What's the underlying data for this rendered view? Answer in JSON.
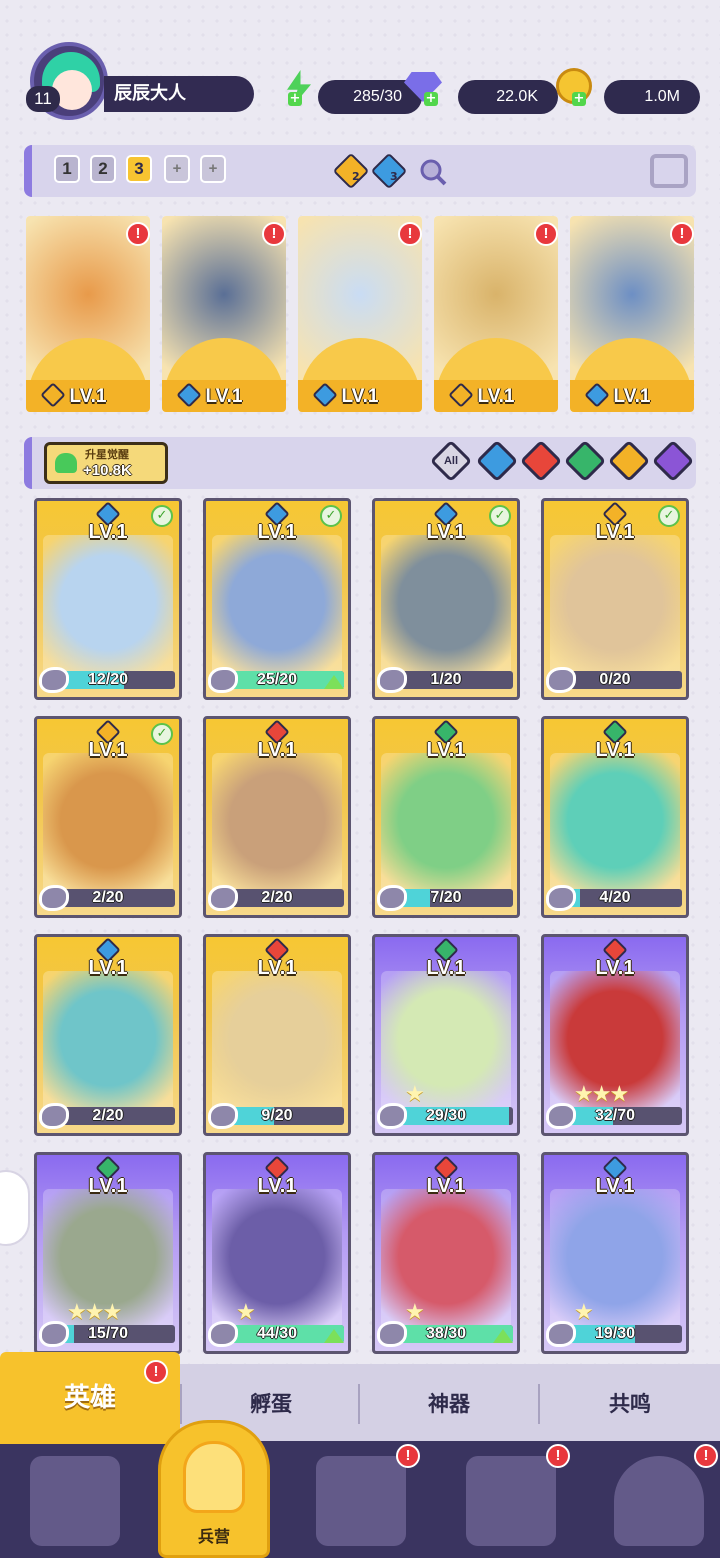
{
  "player": {
    "level": "11",
    "name": "辰辰大人"
  },
  "resources": [
    {
      "name": "energy",
      "icon": "lightning-icon",
      "value": "285/30",
      "color": "#4ed15a"
    },
    {
      "name": "gems",
      "icon": "gem-icon",
      "value": "22.0K",
      "color": "#7a6ee8"
    },
    {
      "name": "coins",
      "icon": "coin-icon",
      "value": "1.0M",
      "color": "#f5c531"
    }
  ],
  "team": {
    "slots": [
      "1",
      "2",
      "3",
      "+",
      "+"
    ],
    "active_slot": "3",
    "element_counts": [
      {
        "icon": "light-element-icon",
        "count": "2",
        "color": "#f3b227"
      },
      {
        "icon": "water-element-icon",
        "count": "3",
        "color": "#3d9be0"
      }
    ],
    "members": [
      {
        "level": "LV.1",
        "element": "light",
        "ecolor": "#f3b227",
        "art": "#e89a4a",
        "alert": "!"
      },
      {
        "level": "LV.1",
        "element": "water",
        "ecolor": "#3d9be0",
        "art": "#5a6f96",
        "alert": "!"
      },
      {
        "level": "LV.1",
        "element": "water",
        "ecolor": "#3d9be0",
        "art": "#c9dcf4",
        "alert": "!"
      },
      {
        "level": "LV.1",
        "element": "light",
        "ecolor": "#f3b227",
        "art": "#d9b36a",
        "alert": "!"
      },
      {
        "level": "LV.1",
        "element": "water",
        "ecolor": "#3d9be0",
        "art": "#6d8fc4",
        "alert": "!"
      }
    ]
  },
  "upgrade": {
    "label": "升星觉醒",
    "value": "+10.8K"
  },
  "filters": [
    {
      "label": "All",
      "color": "#d9d6e3"
    },
    {
      "label": "water",
      "color": "#3d9be0"
    },
    {
      "label": "fire",
      "color": "#e8463a"
    },
    {
      "label": "wind",
      "color": "#37b56a"
    },
    {
      "label": "light",
      "color": "#f3b227"
    },
    {
      "label": "dark",
      "color": "#8b55d6"
    }
  ],
  "heroes": [
    {
      "level": "LV.1",
      "progress": "12/20",
      "ratio": 0.6,
      "element": "water",
      "ecolor": "#3d9be0",
      "tier": "gold",
      "art": "#b8d4ef",
      "check": true,
      "stars": "",
      "up": false
    },
    {
      "level": "LV.1",
      "progress": "25/20",
      "ratio": 1.0,
      "element": "water",
      "ecolor": "#3d9be0",
      "tier": "gold",
      "art": "#8ea9d8",
      "check": true,
      "stars": "",
      "up": true
    },
    {
      "level": "LV.1",
      "progress": "1/20",
      "ratio": 0.05,
      "element": "water",
      "ecolor": "#3d9be0",
      "tier": "gold",
      "art": "#7f8f9c",
      "check": true,
      "stars": "",
      "up": false
    },
    {
      "level": "LV.1",
      "progress": "0/20",
      "ratio": 0.0,
      "element": "light",
      "ecolor": "#f3b227",
      "tier": "gold",
      "art": "#e0c49a",
      "check": true,
      "stars": "",
      "up": false
    },
    {
      "level": "LV.1",
      "progress": "2/20",
      "ratio": 0.1,
      "element": "light",
      "ecolor": "#f3b227",
      "tier": "gold",
      "art": "#d9974c",
      "check": true,
      "stars": "",
      "up": false
    },
    {
      "level": "LV.1",
      "progress": "2/20",
      "ratio": 0.1,
      "element": "fire",
      "ecolor": "#e8463a",
      "tier": "gold",
      "art": "#c9a07a",
      "check": false,
      "stars": "",
      "up": false
    },
    {
      "level": "LV.1",
      "progress": "7/20",
      "ratio": 0.35,
      "element": "wind",
      "ecolor": "#37b56a",
      "tier": "gold",
      "art": "#7fcf86",
      "check": false,
      "stars": "",
      "up": false
    },
    {
      "level": "LV.1",
      "progress": "4/20",
      "ratio": 0.2,
      "element": "wind",
      "ecolor": "#37b56a",
      "tier": "gold",
      "art": "#5ecfb8",
      "check": false,
      "stars": "",
      "up": false
    },
    {
      "level": "LV.1",
      "progress": "2/20",
      "ratio": 0.1,
      "element": "water",
      "ecolor": "#3d9be0",
      "tier": "gold",
      "art": "#6fc5c9",
      "check": false,
      "stars": "",
      "up": false
    },
    {
      "level": "LV.1",
      "progress": "9/20",
      "ratio": 0.45,
      "element": "fire",
      "ecolor": "#e8463a",
      "tier": "gold",
      "art": "#e6cf9a",
      "check": false,
      "stars": "",
      "up": false
    },
    {
      "level": "LV.1",
      "progress": "29/30",
      "ratio": 0.97,
      "element": "wind",
      "ecolor": "#37b56a",
      "tier": "purple",
      "art": "#d4e9b4",
      "check": false,
      "stars": "★",
      "up": false
    },
    {
      "level": "LV.1",
      "progress": "32/70",
      "ratio": 0.46,
      "element": "fire",
      "ecolor": "#e8463a",
      "tier": "purple",
      "art": "#c93a3a",
      "check": false,
      "stars": "★★★",
      "up": false
    },
    {
      "level": "LV.1",
      "progress": "15/70",
      "ratio": 0.21,
      "element": "wind",
      "ecolor": "#37b56a",
      "tier": "purple",
      "art": "#9aa88e",
      "check": false,
      "stars": "★★★",
      "up": false
    },
    {
      "level": "LV.1",
      "progress": "44/30",
      "ratio": 1.0,
      "element": "fire",
      "ecolor": "#e8463a",
      "tier": "purple",
      "art": "#6c5ea8",
      "check": false,
      "stars": "★",
      "up": true
    },
    {
      "level": "LV.1",
      "progress": "38/30",
      "ratio": 1.0,
      "element": "fire",
      "ecolor": "#e8463a",
      "tier": "purple",
      "art": "#d65a6a",
      "check": false,
      "stars": "★",
      "up": true
    },
    {
      "level": "LV.1",
      "progress": "19/30",
      "ratio": 0.63,
      "element": "water",
      "ecolor": "#3d9be0",
      "tier": "purple",
      "art": "#8fa4e8",
      "check": false,
      "stars": "★",
      "up": false
    }
  ],
  "tabs": [
    {
      "label": "英雄",
      "alert": "!"
    },
    {
      "label": "孵蛋"
    },
    {
      "label": "神器"
    },
    {
      "label": "共鸣"
    }
  ],
  "nav": [
    {
      "name": "cards",
      "icon": "cards-icon",
      "alert": ""
    },
    {
      "name": "barracks",
      "icon": "barracks-icon",
      "label": "兵营",
      "alert": ""
    },
    {
      "name": "map",
      "icon": "map-icon",
      "alert": "!"
    },
    {
      "name": "shop",
      "icon": "shop-icon",
      "alert": "!"
    },
    {
      "name": "guild",
      "icon": "guild-icon",
      "alert": "!"
    }
  ]
}
